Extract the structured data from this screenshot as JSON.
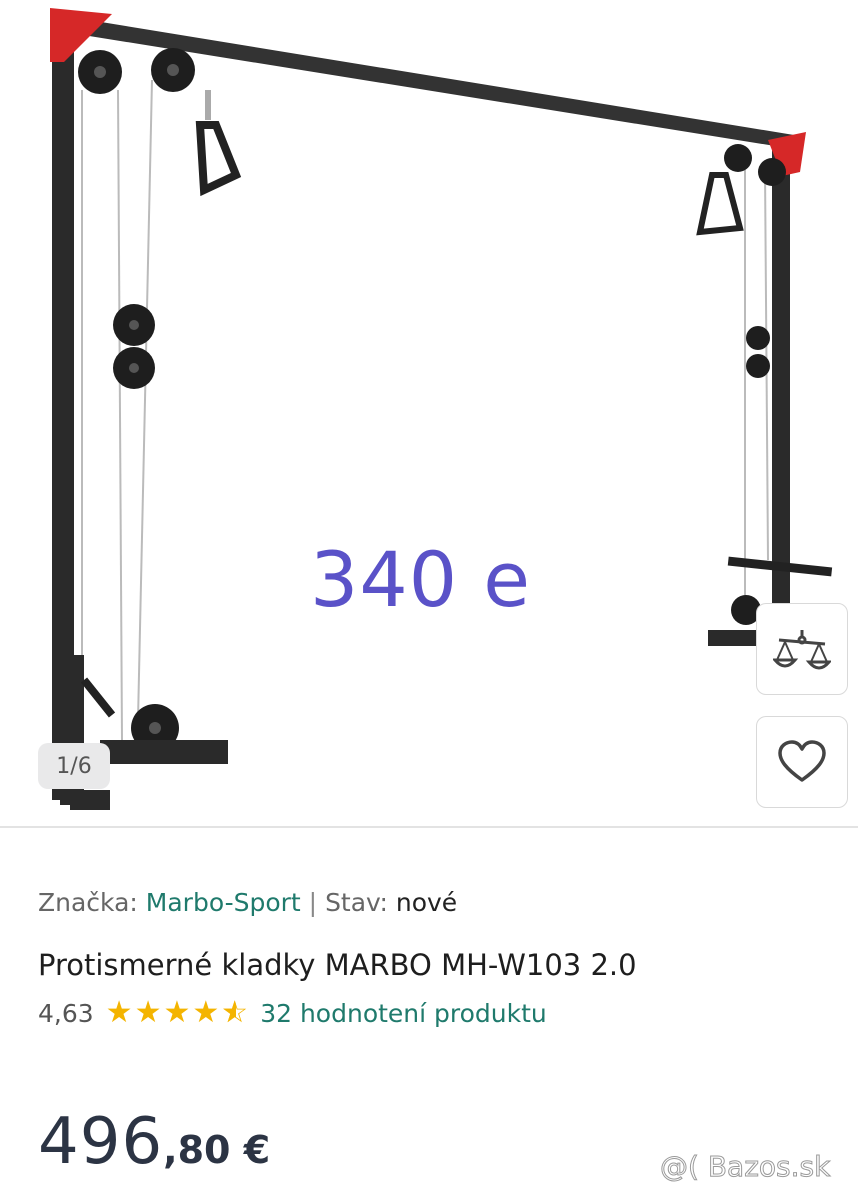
{
  "gallery": {
    "image_alt": "Protismerné kladky MARBO MH-W103 2.0",
    "overlay_price": "340 e",
    "counter": "1/6",
    "compare_icon": "scales-icon",
    "favorite_icon": "heart-icon"
  },
  "product": {
    "brand_label": "Značka:",
    "brand_value": "Marbo-Sport",
    "separator": "|",
    "condition_label": "Stav:",
    "condition_value": "nové",
    "title": "Protismerné kladky MARBO MH-W103 2.0",
    "rating_value": "4,63",
    "rating_fraction": 0.926,
    "reviews_text": "32 hodnotení produktu",
    "price_int": "496",
    "price_frac": ",80 €"
  },
  "watermark": "@( Bazos.sk",
  "colors": {
    "accent_link": "#1f7a6c",
    "star": "#f4b400",
    "overlay_price": "#5a52c8",
    "price": "#2c3444"
  }
}
